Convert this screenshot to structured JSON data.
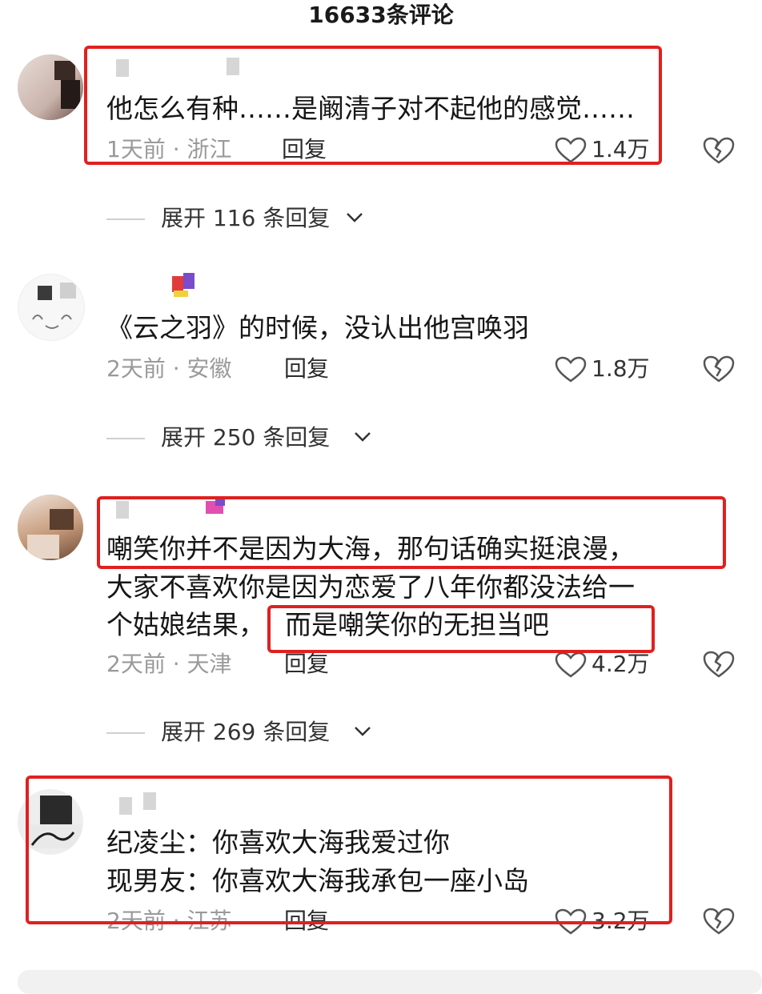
{
  "header": {
    "title": "16633条评论"
  },
  "colors": {
    "highlight": "#e02020",
    "meta": "#9a9a9a",
    "text": "#161616"
  },
  "comments": [
    {
      "lines": [
        "他怎么有种……是阚清子对不起他的感觉……"
      ],
      "time_location": "1天前 · 浙江",
      "reply_label": "回复",
      "likes": "1.4万",
      "expand_label": "展开 116 条回复"
    },
    {
      "lines": [
        "《云之羽》的时候，没认出他宫唤羽"
      ],
      "time_location": "2天前 · 安徽",
      "reply_label": "回复",
      "likes": "1.8万",
      "expand_label": "展开 250 条回复"
    },
    {
      "lines": [
        "嘲笑你并不是因为大海，那句话确实挺浪漫，",
        "大家不喜欢你是因为恋爱了八年你都没法给一",
        "个姑娘结果，"
      ],
      "highlight_fragment": "而是嘲笑你的无担当吧",
      "time_location": "2天前 · 天津",
      "reply_label": "回复",
      "likes": "4.2万",
      "expand_label": "展开 269 条回复"
    },
    {
      "lines": [
        "纪凌尘：你喜欢大海我爱过你",
        "现男友：你喜欢大海我承包一座小岛"
      ],
      "time_location": "2天前 · 江苏",
      "reply_label": "回复",
      "likes": "3.2万"
    }
  ],
  "icons": {
    "like": "heart-outline-icon",
    "dislike": "broken-heart-icon",
    "expand": "chevron-down-icon"
  }
}
